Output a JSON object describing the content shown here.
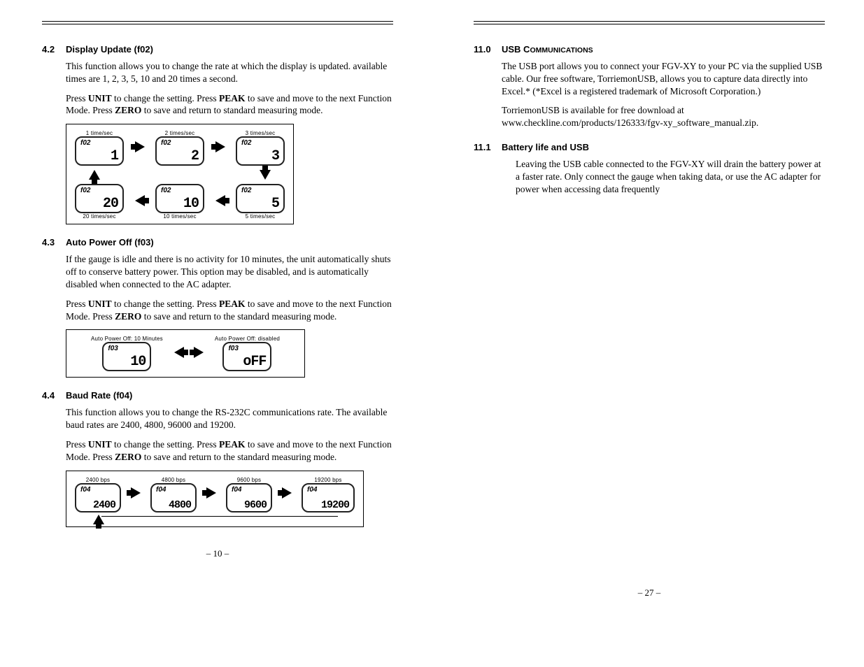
{
  "left": {
    "s42": {
      "num": "4.2",
      "title": "Display Update (f02)",
      "p1": "This function allows you to change the rate at which the display is updated. available times are 1, 2, 3, 5, 10 and 20 times a second.",
      "p2a": "Press ",
      "p2b": " to change the setting. Press ",
      "p2c": " to save and move to the next Function Mode. Press ",
      "p2d": " to save and return to standard measuring mode.",
      "unit": "UNIT",
      "peak": "PEAK",
      "zero": "ZERO",
      "cells": [
        {
          "cap": "1 time/sec",
          "fn": "f02",
          "val": "1"
        },
        {
          "cap": "2 times/sec",
          "fn": "f02",
          "val": "2"
        },
        {
          "cap": "3 times/sec",
          "fn": "f02",
          "val": "3"
        },
        {
          "cap": "20 times/sec",
          "fn": "f02",
          "val": "20"
        },
        {
          "cap": "10 times/sec",
          "fn": "f02",
          "val": "10"
        },
        {
          "cap": "5 times/sec",
          "fn": "f02",
          "val": "5"
        }
      ]
    },
    "s43": {
      "num": "4.3",
      "title": "Auto Power Off (f03)",
      "p1": "If the gauge is idle and there is no activity for 10 minutes, the unit automatically shuts off to conserve battery power. This option may be disabled, and is automatically disabled when connected to the AC adapter.",
      "p2a": "Press ",
      "p2b": " to change the setting. Press ",
      "p2c": " to save and move to the next Function Mode. Press ",
      "p2d": " to save and return to the standard measuring mode.",
      "cells": [
        {
          "cap": "Auto Power Off: 10 Minutes",
          "fn": "f03",
          "val": "10"
        },
        {
          "cap": "Auto Power Off: disabled",
          "fn": "f03",
          "val": "oFF"
        }
      ]
    },
    "s44": {
      "num": "4.4",
      "title": "Baud Rate (f04)",
      "p1": "This function allows you to change the RS-232C communications rate. The available baud rates are 2400, 4800, 96000 and 19200.",
      "p2a": "Press ",
      "p2b": " to change the setting. Press ",
      "p2c": " to save and move to the next Function Mode. Press ",
      "p2d": " to save and return to the standard measuring mode.",
      "cells": [
        {
          "cap": "2400 bps",
          "fn": "f04",
          "val": "2400"
        },
        {
          "cap": "4800 bps",
          "fn": "f04",
          "val": "4800"
        },
        {
          "cap": "9600 bps",
          "fn": "f04",
          "val": "9600"
        },
        {
          "cap": "19200 bps",
          "fn": "f04",
          "val": "19200"
        }
      ]
    },
    "pgnum": "– 10 –"
  },
  "right": {
    "s11": {
      "num": "11.0",
      "title_a": "USB C",
      "title_b": "OMMUNICATIONS",
      "p1": "The USB port allows you to connect your FGV-XY to your PC via the supplied USB cable. Our free software, TorriemonUSB, allows you to capture data directly into Excel.* (*Excel is a registered trademark of Microsoft Corporation.)",
      "p2": "TorriemonUSB is available for free download at www.checkline.com/products/126333/fgv-xy_software_manual.zip."
    },
    "s111": {
      "num": "11.1",
      "title": "Battery life and USB",
      "p1": "Leaving the USB cable connected to the FGV-XY will drain the battery power at a faster rate. Only connect the gauge when taking data, or use the AC adapter for power when accessing data frequently"
    },
    "pgnum": "– 27 –"
  }
}
